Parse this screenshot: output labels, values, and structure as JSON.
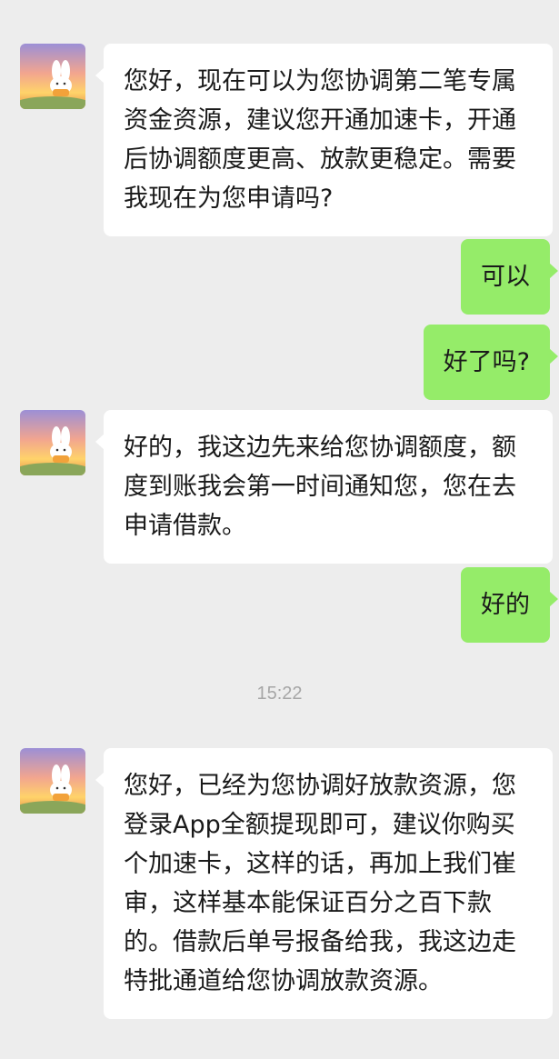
{
  "conversation": {
    "timestamp": "15:22",
    "messages": [
      {
        "side": "in",
        "text": "您好，现在可以为您协调第二笔专属资金资源，建议您开通加速卡，开通后协调额度更高、放款更稳定。需要我现在为您申请吗?"
      },
      {
        "side": "out",
        "text": "可以"
      },
      {
        "side": "out",
        "text": "好了吗?"
      },
      {
        "side": "in",
        "text": "好的，我这边先来给您协调额度，额度到账我会第一时间通知您，您在去申请借款。"
      },
      {
        "side": "out",
        "text": "好的"
      },
      {
        "side": "in",
        "text": "您好，已经为您协调好放款资源，您登录App全额提现即可，建议你购买个加速卡，这样的话，再加上我们崔审，这样基本能保证百分之百下款的。借款后单号报备给我，我这边走特批通道给您协调放款资源。"
      }
    ]
  },
  "avatar": {
    "icon": "bunny-sunset-avatar-icon"
  },
  "colors": {
    "background": "#ededed",
    "incoming_bubble": "#ffffff",
    "outgoing_bubble": "#95ec69",
    "timestamp": "#a6a6a6"
  }
}
